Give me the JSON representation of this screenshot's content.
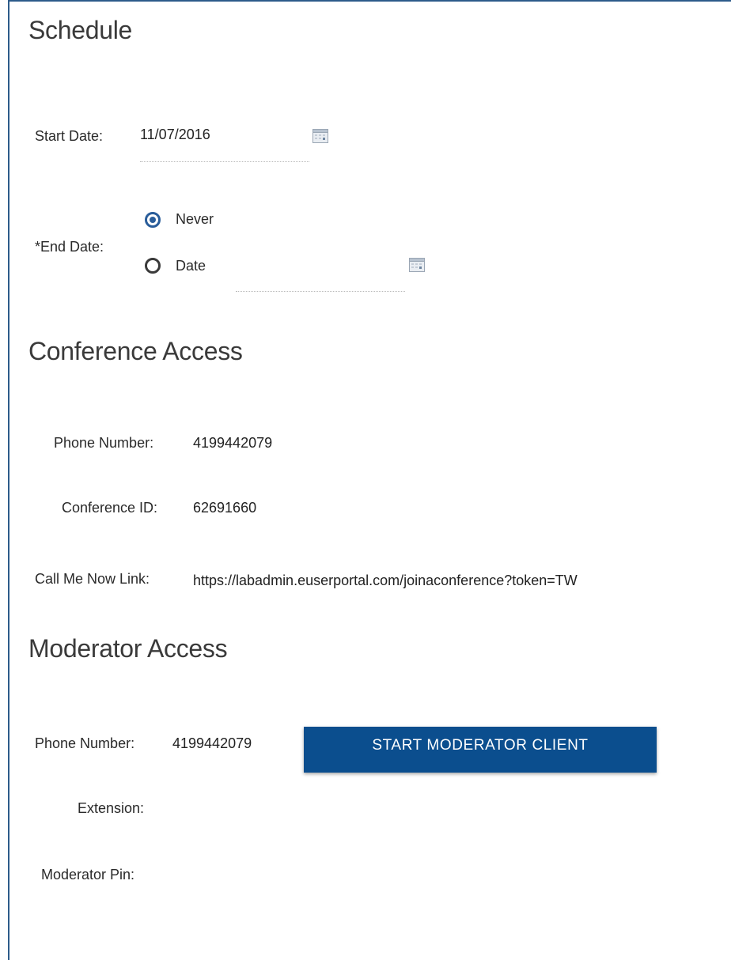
{
  "schedule": {
    "title": "Schedule",
    "start_date": {
      "label": "Start Date:",
      "value": "11/07/2016",
      "icon": "calendar-icon"
    },
    "end_date": {
      "label": "*End Date:",
      "options": [
        {
          "label": "Never",
          "selected": true
        },
        {
          "label": "Date",
          "selected": false
        }
      ],
      "date_value": "",
      "icon": "calendar-icon"
    }
  },
  "conference_access": {
    "title": "Conference Access",
    "phone_number": {
      "label": "Phone Number:",
      "value": "4199442079"
    },
    "conference_id": {
      "label": "Conference ID:",
      "value": "62691660"
    },
    "call_me_now_link": {
      "label": "Call Me Now Link:",
      "value": "https://labadmin.euserportal.com/joinaconference?token=TW"
    }
  },
  "moderator_access": {
    "title": "Moderator Access",
    "phone_number": {
      "label": "Phone Number:",
      "value": "4199442079"
    },
    "start_button_label": "START MODERATOR CLIENT",
    "extension": {
      "label": "Extension:",
      "value": ""
    },
    "moderator_pin": {
      "label": "Moderator Pin:",
      "value": ""
    }
  },
  "colors": {
    "accent": "#0b4e8e",
    "radio_selected": "#2a5d9a",
    "frame_border": "#2d5b8a"
  }
}
